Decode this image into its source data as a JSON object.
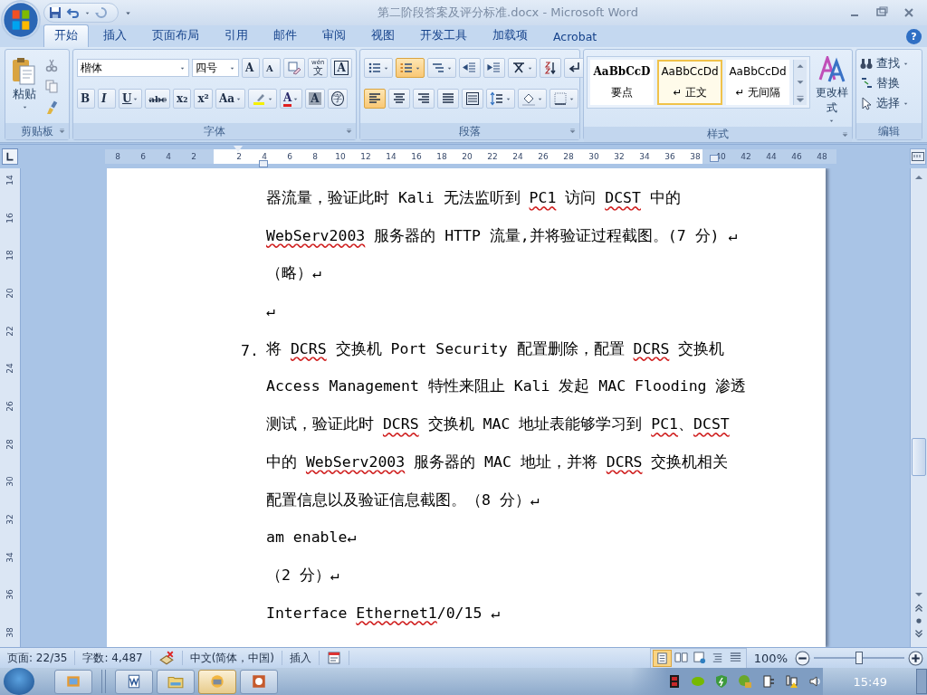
{
  "window": {
    "title": "第二阶段答案及评分标准.docx - Microsoft Word"
  },
  "tabs": [
    {
      "label": "开始",
      "selected": true
    },
    {
      "label": "插入",
      "selected": false
    },
    {
      "label": "页面布局",
      "selected": false
    },
    {
      "label": "引用",
      "selected": false
    },
    {
      "label": "邮件",
      "selected": false
    },
    {
      "label": "审阅",
      "selected": false
    },
    {
      "label": "视图",
      "selected": false
    },
    {
      "label": "开发工具",
      "selected": false
    },
    {
      "label": "加载项",
      "selected": false
    },
    {
      "label": "Acrobat",
      "selected": false
    }
  ],
  "help": "?",
  "ribbon": {
    "clipboard": {
      "label": "剪贴板",
      "paste": "粘贴"
    },
    "font": {
      "label": "字体",
      "font_name": "楷体",
      "font_size": "四号",
      "row1": [
        {
          "kind": "glyph",
          "label": "A"
        },
        {
          "kind": "glyph",
          "label": "A"
        },
        {
          "kind": "icon"
        },
        {
          "kind": "glyph",
          "label": "文",
          "ruby": "wén"
        },
        {
          "kind": "glyph",
          "label": "A"
        }
      ],
      "row2": [
        {
          "kind": "glyph",
          "label": "B"
        },
        {
          "kind": "glyph",
          "label": "I"
        },
        {
          "kind": "glyph",
          "label": "U"
        },
        {
          "kind": "glyph",
          "label": "abc"
        },
        {
          "kind": "glyph",
          "label": "x₂"
        },
        {
          "kind": "glyph",
          "label": "x²"
        },
        {
          "kind": "glyph",
          "label": "Aa"
        },
        {
          "kind": "icon"
        },
        {
          "kind": "glyph",
          "label": "A"
        },
        {
          "kind": "glyph",
          "label": "A"
        },
        {
          "kind": "glyph",
          "label": "字"
        }
      ]
    },
    "paragraph": {
      "label": "段落",
      "row1": [
        {
          "selected": false
        },
        {
          "selected": true
        },
        {
          "selected": false
        },
        {
          "selected": false
        },
        {
          "selected": false
        },
        {
          "selected": false
        },
        {
          "selected": false
        },
        {
          "selected": false
        }
      ],
      "row2": [
        {
          "selected": true
        },
        {
          "selected": false
        },
        {
          "selected": false
        },
        {
          "selected": false
        },
        {
          "selected": false
        },
        {
          "selected": false
        },
        {
          "selected": false
        },
        {
          "selected": false
        }
      ]
    },
    "styles": {
      "label": "样式",
      "items": [
        {
          "preview": "AaBbCcD",
          "name": "要点",
          "selected": false
        },
        {
          "preview": "AaBbCcDd",
          "name": "↵ 正文",
          "selected": true
        },
        {
          "preview": "AaBbCcDd",
          "name": "↵ 无间隔",
          "selected": false
        }
      ],
      "change_styles": "更改样式"
    },
    "editing": {
      "label": "编辑",
      "items": [
        {
          "label": "查找"
        },
        {
          "label": "替换"
        },
        {
          "label": "选择"
        }
      ]
    }
  },
  "ruler": {
    "left_numbers": [
      "8",
      "6",
      "4",
      "2"
    ],
    "right_numbers": [
      "2",
      "4",
      "6",
      "8",
      "10",
      "12",
      "14",
      "16",
      "18",
      "20",
      "22",
      "24",
      "26",
      "28",
      "30",
      "32",
      "34",
      "36",
      "38",
      "40",
      "42",
      "44",
      "46",
      "48"
    ]
  },
  "vertical_ruler": [
    "14",
    "16",
    "18",
    "20",
    "22",
    "24",
    "26",
    "28",
    "30",
    "32",
    "34",
    "36",
    "38"
  ],
  "document": {
    "paragraphs": [
      {
        "kind": "text",
        "lines": [
          [
            {
              "t": "器流量，验证此时 Kali 无法监听到 "
            },
            {
              "t": "PC1",
              "err": true
            },
            {
              "t": " 访问 "
            },
            {
              "t": "DCST",
              "err": true
            },
            {
              "t": " 中的"
            }
          ],
          [
            {
              "t": "WebServ2003",
              "err": true
            },
            {
              "t": " 服务器的 HTTP 流量,并将验证过程截图。(7 分) ↵"
            }
          ]
        ]
      },
      {
        "kind": "text",
        "lines": [
          [
            {
              "t": "（略）↵"
            }
          ]
        ]
      },
      {
        "kind": "text",
        "lines": [
          [
            {
              "t": "↵"
            }
          ]
        ]
      },
      {
        "kind": "numbered",
        "number": "7.",
        "lines": [
          [
            {
              "t": "将 "
            },
            {
              "t": "DCRS",
              "err": true
            },
            {
              "t": " 交换机 Port Security 配置删除，配置 "
            },
            {
              "t": "DCRS",
              "err": true
            },
            {
              "t": " 交换机"
            }
          ],
          [
            {
              "t": "Access Management 特性来阻止 Kali 发起 MAC Flooding 渗透"
            }
          ],
          [
            {
              "t": "测试，验证此时 "
            },
            {
              "t": "DCRS",
              "err": true
            },
            {
              "t": " 交换机 MAC 地址表能够学习到 "
            },
            {
              "t": "PC1",
              "err": true
            },
            {
              "t": "、"
            },
            {
              "t": "DCST",
              "err": true
            }
          ],
          [
            {
              "t": "中的 "
            },
            {
              "t": "WebServ2003",
              "err": true
            },
            {
              "t": " 服务器的 MAC 地址，并将 "
            },
            {
              "t": "DCRS",
              "err": true
            },
            {
              "t": " 交换机相关"
            }
          ],
          [
            {
              "t": "配置信息以及验证信息截图。（8 分）↵"
            }
          ]
        ]
      },
      {
        "kind": "text",
        "lines": [
          [
            {
              "t": "am enable↵"
            }
          ]
        ]
      },
      {
        "kind": "text",
        "lines": [
          [
            {
              "t": "（2 分）↵"
            }
          ]
        ]
      },
      {
        "kind": "text",
        "lines": [
          [
            {
              "t": "Interface "
            },
            {
              "t": "Ethernet1",
              "err": true
            },
            {
              "t": "/0/15 ↵"
            }
          ]
        ]
      }
    ]
  },
  "status_bar": {
    "page": "页面: 22/35",
    "words": "字数: 4,487",
    "language": "中文(简体，中国)",
    "mode": "插入",
    "views": [
      {
        "selected": true
      },
      {
        "selected": false
      },
      {
        "selected": false
      },
      {
        "selected": false
      },
      {
        "selected": false
      }
    ],
    "zoom": "100%",
    "zoom_slider": {
      "level": 0.5
    }
  },
  "taskbar": {
    "buttons": [
      {
        "selected": false
      },
      {
        "selected": false
      },
      {
        "selected": false
      },
      {
        "selected": true
      },
      {
        "selected": false
      }
    ],
    "time": "15:49"
  }
}
